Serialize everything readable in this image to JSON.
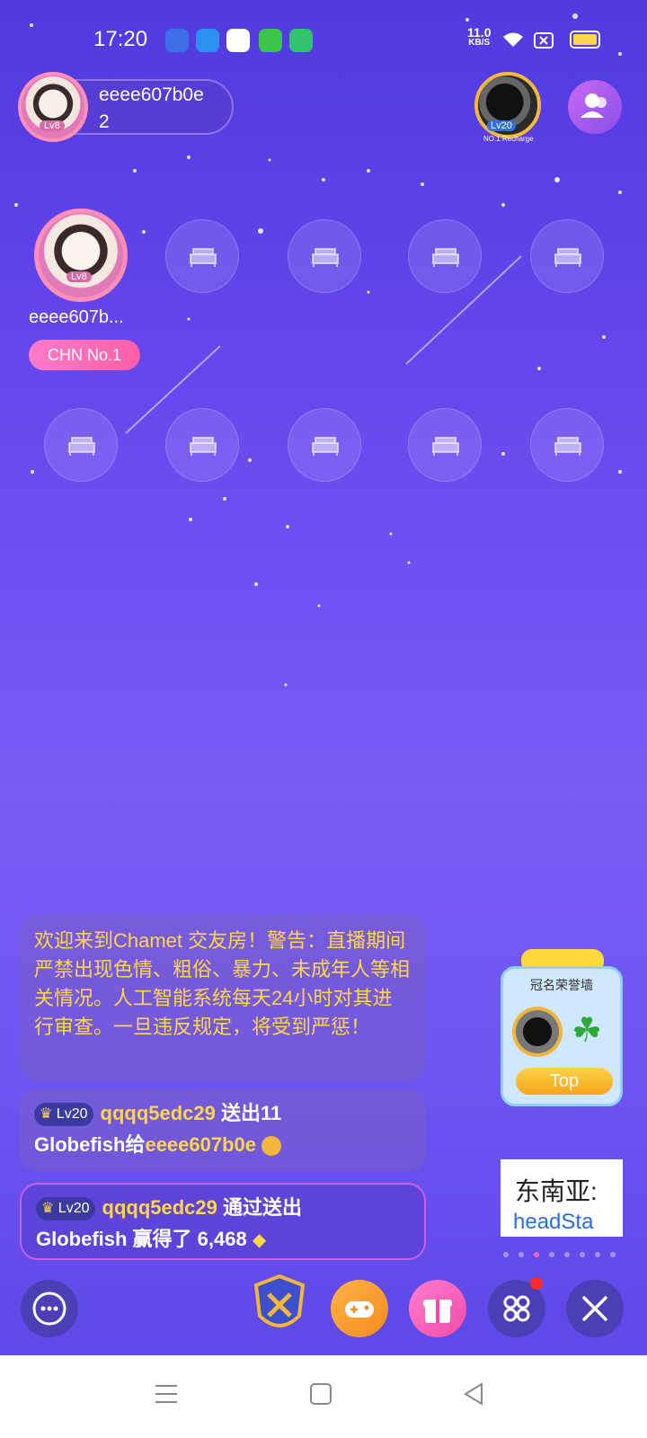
{
  "status_bar": {
    "time": "17:20",
    "net_speed_value": "11.0",
    "net_speed_unit": "KB/S",
    "icons": [
      "baidu-app-icon",
      "browser-app-icon",
      "video-app-icon",
      "store-app-icon",
      "security-app-icon",
      "wifi-icon",
      "sim-icon",
      "battery-icon"
    ]
  },
  "header": {
    "host_name": "eeee607b0e",
    "host_count": "2",
    "host_level": "Lv8",
    "rank_level": "Lv20",
    "rank_caption": "NO.1 Recharge"
  },
  "seats": {
    "host_name": "eeee607b...",
    "host_level": "Lv8",
    "host_badge": "CHN No.1"
  },
  "chat": {
    "notice": "欢迎来到Chamet 交友房！警告：直播期间严禁出现色情、粗俗、暴力、未成年人等相关情况。人工智能系统每天24小时对其进行审查。一旦违反规定，将受到严惩！",
    "msg1": {
      "level": "Lv20",
      "user": "qqqq5edc29",
      "action": "送出11",
      "gift": "Globefish给",
      "target": "eeee607b0e"
    },
    "msg2": {
      "level": "Lv20",
      "user": "qqqq5edc29",
      "action": "通过送出",
      "gift": "Globefish 赢得了 6,468"
    }
  },
  "honor_wall": {
    "title": "冠名荣誉墙",
    "button": "Top"
  },
  "banner": {
    "line1": "东南亚:",
    "line2": "headSta"
  },
  "colors": {
    "accent_yellow": "#ffd54a",
    "badge_pink": "#ff5fa8",
    "bg_purple": "#6a49ef"
  }
}
